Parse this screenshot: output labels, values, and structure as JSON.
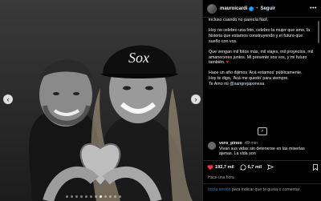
{
  "post": {
    "username": "mauroicardi",
    "separator": "•",
    "follow_label": "Seguir",
    "more_label": "•••"
  },
  "caption": {
    "paragraphs": [
      "incluso cuando no parecía fácil.",
      "Hoy no celebro una foto, celebro la mujer que amo, la historia que estamos construyendo y el futuro que sueño con vos.",
      "Que vengan mil fotos más, mil viajes, mil proyectos, mil amaneceres juntos. Mi presente sos vos, y mi futuro también.",
      "Hace un año dijimos 'Acá estamos' públicamente.",
      "Hoy te digo, 'Acá me quedo' para siempre.",
      "Te Amo mi"
    ],
    "heart": "♥",
    "tag": "@sangrejaponesa"
  },
  "comment": {
    "username": "vero_pinoo",
    "time": "49 min",
    "text": "Vivan sus vidas sin detenerse en las miserias ajenas. La vida son"
  },
  "actions": {
    "likes": "192,7 mil",
    "comments": "6,7 mil"
  },
  "posted_ago": "Hace una hora",
  "login": {
    "link": "Inicia sesión",
    "text": " para indicar que te gusta o comentar."
  },
  "colors": {
    "accent_blue": "#0095f6",
    "heart_red": "#ff3040",
    "panel_bg": "#000000",
    "muted_text": "#a8a8a8"
  },
  "image": {
    "description_icons": [
      "person-left",
      "person-right-cap",
      "heart-hands"
    ],
    "carousel_total": 12,
    "carousel_active": 8
  }
}
